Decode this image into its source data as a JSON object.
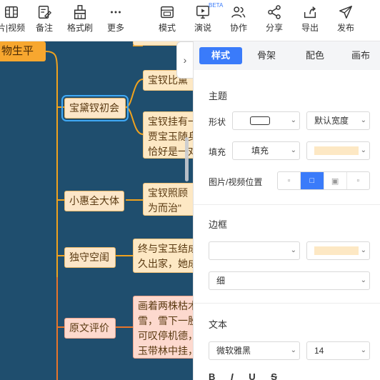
{
  "toolbar": {
    "items": [
      {
        "label": "片|视频",
        "icon": "film-icon"
      },
      {
        "label": "备注",
        "icon": "note-icon"
      },
      {
        "label": "格式刷",
        "icon": "format-brush-icon"
      },
      {
        "label": "更多",
        "icon": "more-icon"
      },
      {
        "label": "模式",
        "icon": "mode-icon"
      },
      {
        "label": "演说",
        "icon": "present-icon"
      },
      {
        "label": "协作",
        "icon": "collaborate-icon"
      },
      {
        "label": "分享",
        "icon": "share-icon"
      },
      {
        "label": "导出",
        "icon": "export-icon"
      },
      {
        "label": "发布",
        "icon": "publish-icon"
      }
    ],
    "beta_badge": "BETA"
  },
  "mindmap": {
    "root": "物生平",
    "branches": [
      {
        "label": "宝黛钗初会",
        "selected": true
      },
      {
        "label": "小惠全大体"
      },
      {
        "label": "独守空闺"
      },
      {
        "label": "原文评价"
      }
    ],
    "leaves": [
      {
        "text": "宝钗比黛"
      },
      {
        "text": "宝钗挂有一\n贾宝玉随身\n恰好是一对"
      },
      {
        "text": "宝钗照顾\n为而治\""
      },
      {
        "text": "终与宝玉结成\n久出家，她成"
      },
      {
        "text": "画着两株枯木\n雪，雪下一股\n可叹停机德，\n玉带林中挂，"
      }
    ],
    "collapse_icon": "chevron-right-icon"
  },
  "panel": {
    "tabs": [
      "样式",
      "骨架",
      "配色",
      "画布"
    ],
    "active_tab": "样式",
    "theme_section": "主题",
    "shape_label": "形状",
    "shape_width": "默认宽度",
    "fill_label": "填充",
    "fill_value": "填充",
    "fill_color": "#fde8c4",
    "image_pos_label": "图片/视频位置",
    "border_section": "边框",
    "border_color": "#fde8c4",
    "border_weight": "细",
    "text_section": "文本",
    "font_family": "微软雅黑",
    "font_size": "14"
  }
}
